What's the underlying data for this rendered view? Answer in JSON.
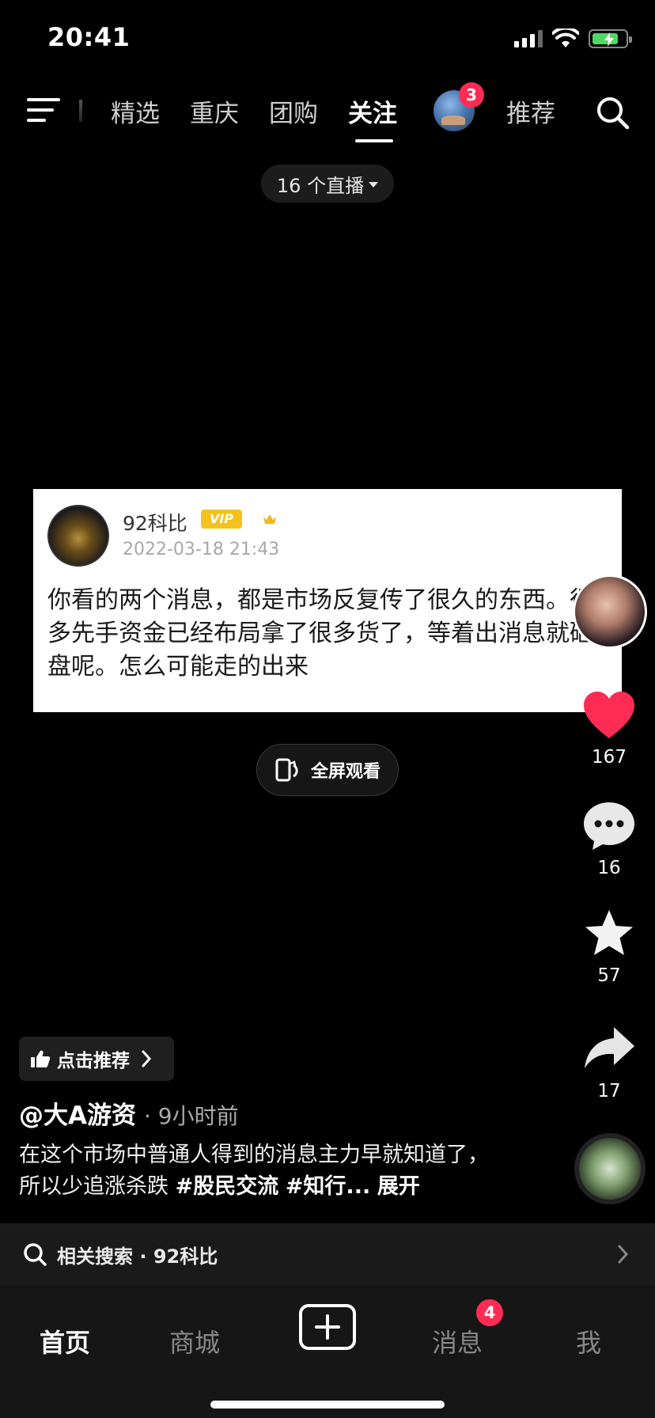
{
  "status_bar": {
    "time": "20:41"
  },
  "top_nav": {
    "tabs": [
      "精选",
      "重庆",
      "团购",
      "关注",
      "推荐"
    ],
    "active_tab": "关注",
    "avatar_badge": "3"
  },
  "live": {
    "label": "16 个直播"
  },
  "post_card": {
    "username": "92科比",
    "vip_label": "VIP",
    "date": "2022-03-18 21:43",
    "text": "你看的两个消息，都是市场反复传了很久的东西。很多先手资金已经布局拿了很多货了，等着出消息就砸盘呢。怎么可能走的出来"
  },
  "fullscreen": {
    "label": "全屏观看"
  },
  "actions": {
    "likes": "167",
    "comments": "16",
    "favorites": "57",
    "shares": "17",
    "like_color": "#fe2c55"
  },
  "recommend": {
    "label": "点击推荐"
  },
  "author": {
    "handle": "@大A游资",
    "time": "· 9小时前"
  },
  "caption": {
    "text": "在这个市场中普通人得到的消息主力早就知道了，所以少追涨杀跌 ",
    "tag1": "#股民交流",
    "tag2": "#知行...",
    "expand": "展开"
  },
  "related_search": {
    "label": "相关搜索 · 92科比"
  },
  "tab_bar": {
    "home": "首页",
    "mall": "商城",
    "messages": "消息",
    "messages_badge": "4",
    "me": "我"
  }
}
